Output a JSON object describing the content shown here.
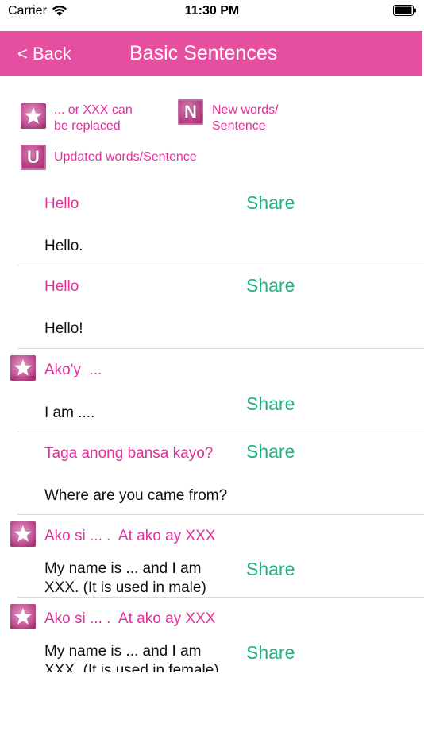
{
  "status_bar": {
    "carrier": "Carrier",
    "time": "11:30 PM"
  },
  "nav": {
    "back_label": "< Back",
    "title": "Basic Sentences"
  },
  "legend": {
    "replaceable": "... or XXX can\nbe replaced",
    "new_words": "New words/\nSentence",
    "updated_words": "Updated words/Sentence",
    "new_badge": "N",
    "updated_badge": "U"
  },
  "rows": [
    {
      "phrase": "Hello",
      "translation": "Hello.",
      "share": "Share",
      "replaceable": false
    },
    {
      "phrase": "Hello",
      "translation": "Hello!",
      "share": "Share",
      "replaceable": false
    },
    {
      "phrase": "Ako'y  ...",
      "translation": "I am ....",
      "share": "Share",
      "replaceable": true
    },
    {
      "phrase": "Taga anong bansa kayo?",
      "translation": "Where are you came from?",
      "share": "Share",
      "replaceable": false
    },
    {
      "phrase": "Ako si ... .  At ako ay XXX",
      "translation": "My name is ... and I am XXX. (It is used in male)",
      "share": "Share",
      "replaceable": true
    },
    {
      "phrase": "Ako si ... .  At ako ay XXX",
      "translation": "My name is ... and I am XXX. (It is used in female)",
      "share": "Share",
      "replaceable": true
    }
  ],
  "colors": {
    "nav_background": "#e64e9f",
    "phrase_text": "#e0309a",
    "share_text": "#1fb27c"
  }
}
